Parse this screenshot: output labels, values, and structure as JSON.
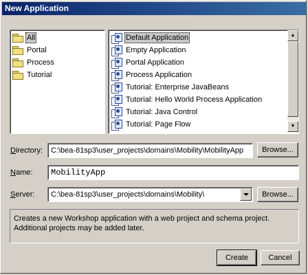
{
  "window": {
    "title": "New Application"
  },
  "categories": [
    {
      "label": "All",
      "selected": true
    },
    {
      "label": "Portal",
      "selected": false
    },
    {
      "label": "Process",
      "selected": false
    },
    {
      "label": "Tutorial",
      "selected": false
    }
  ],
  "templates": [
    {
      "label": "Default Application",
      "selected": true
    },
    {
      "label": "Empty Application",
      "selected": false
    },
    {
      "label": "Portal Application",
      "selected": false
    },
    {
      "label": "Process Application",
      "selected": false
    },
    {
      "label": "Tutorial: Enterprise JavaBeans",
      "selected": false
    },
    {
      "label": "Tutorial: Hello World Process Application",
      "selected": false
    },
    {
      "label": "Tutorial: Java Control",
      "selected": false
    },
    {
      "label": "Tutorial: Page Flow",
      "selected": false
    }
  ],
  "form": {
    "directory_label_key": "D",
    "directory_label_rest": "irectory:",
    "directory_value": "C:\\bea-81sp3\\user_projects\\domains\\Mobility\\MobilityApp",
    "name_label_key": "N",
    "name_label_rest": "ame:",
    "name_value": "MobilityApp",
    "server_label_key": "S",
    "server_label_rest": "erver:",
    "server_value": "C:\\bea-81sp3\\user_projects\\domains\\Mobility\\",
    "browse_label": "Browse..."
  },
  "description": {
    "line1": "Creates a new Workshop application with a web project and schema project.",
    "line2": "Additional projects may be added later."
  },
  "buttons": {
    "create": "Create",
    "cancel": "Cancel"
  }
}
